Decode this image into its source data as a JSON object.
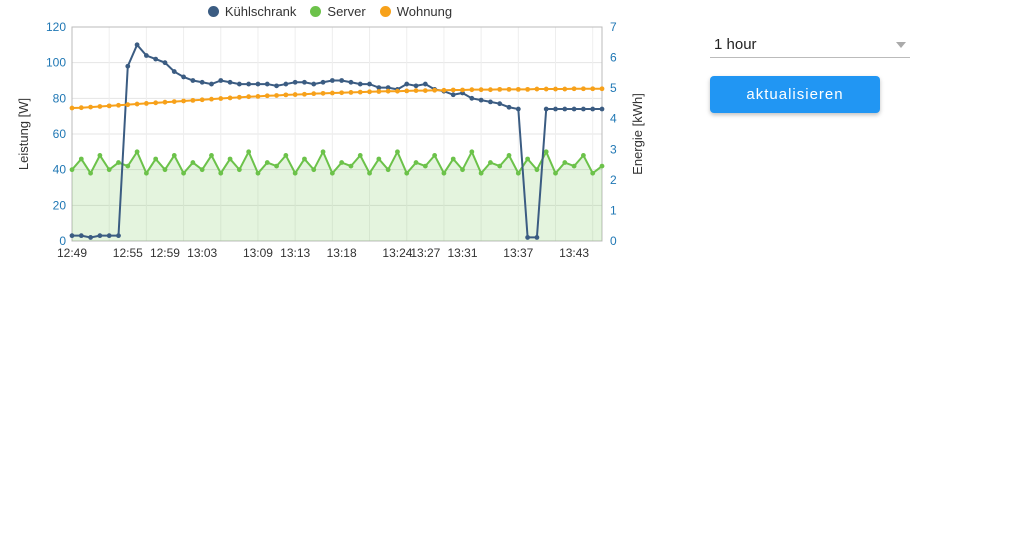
{
  "legend": {
    "items": [
      {
        "name": "Kühlschrank",
        "color": "#3b5c82"
      },
      {
        "name": "Server",
        "color": "#6cc24a"
      },
      {
        "name": "Wohnung",
        "color": "#f7a11a"
      }
    ]
  },
  "controls": {
    "range_selected": "1 hour",
    "refresh_label": "aktualisieren"
  },
  "chart_data": {
    "type": "line",
    "xlabel": "",
    "ylabel_left": "Leistung [W]",
    "ylabel_right": "Energie [kWh]",
    "ylim_left": [
      0,
      120
    ],
    "ylim_right": [
      0,
      7
    ],
    "yticks_left": [
      0,
      20,
      40,
      60,
      80,
      100,
      120
    ],
    "yticks_right": [
      0,
      1,
      2,
      3,
      4,
      5,
      6,
      7
    ],
    "xticks": [
      "12:49",
      "12:55",
      "12:59",
      "13:03",
      "13:09",
      "13:13",
      "13:18",
      "13:24",
      "13:27",
      "13:31",
      "13:37",
      "13:43"
    ],
    "x": [
      "12:49",
      "12:50",
      "12:51",
      "12:52",
      "12:53",
      "12:54",
      "12:55",
      "12:56",
      "12:57",
      "12:58",
      "12:59",
      "13:00",
      "13:01",
      "13:02",
      "13:03",
      "13:04",
      "13:05",
      "13:06",
      "13:07",
      "13:08",
      "13:09",
      "13:10",
      "13:11",
      "13:12",
      "13:13",
      "13:14",
      "13:15",
      "13:16",
      "13:17",
      "13:18",
      "13:19",
      "13:20",
      "13:21",
      "13:22",
      "13:23",
      "13:24",
      "13:25",
      "13:26",
      "13:27",
      "13:28",
      "13:29",
      "13:30",
      "13:31",
      "13:32",
      "13:33",
      "13:34",
      "13:35",
      "13:36",
      "13:37",
      "13:38",
      "13:39",
      "13:40",
      "13:41",
      "13:42",
      "13:43",
      "13:44",
      "13:45",
      "13:46"
    ],
    "series": [
      {
        "name": "Kühlschrank",
        "axis": "left",
        "color": "#3b5c82",
        "fill": false,
        "values": [
          3,
          3,
          2,
          3,
          3,
          3,
          98,
          110,
          104,
          102,
          100,
          95,
          92,
          90,
          89,
          88,
          90,
          89,
          88,
          88,
          88,
          88,
          87,
          88,
          89,
          89,
          88,
          89,
          90,
          90,
          89,
          88,
          88,
          86,
          86,
          85,
          88,
          87,
          88,
          85,
          84,
          82,
          83,
          80,
          79,
          78,
          77,
          75,
          74,
          2,
          2,
          74,
          74,
          74,
          74,
          74,
          74,
          74
        ]
      },
      {
        "name": "Server",
        "axis": "left",
        "color": "#6cc24a",
        "fill": true,
        "values": [
          40,
          46,
          38,
          48,
          40,
          44,
          42,
          50,
          38,
          46,
          40,
          48,
          38,
          44,
          40,
          48,
          38,
          46,
          40,
          50,
          38,
          44,
          42,
          48,
          38,
          46,
          40,
          50,
          38,
          44,
          42,
          48,
          38,
          46,
          40,
          50,
          38,
          44,
          42,
          48,
          38,
          46,
          40,
          50,
          38,
          44,
          42,
          48,
          38,
          46,
          40,
          50,
          38,
          44,
          42,
          48,
          38,
          42
        ]
      },
      {
        "name": "Wohnung",
        "axis": "right",
        "color": "#f7a11a",
        "fill": false,
        "values": [
          4.35,
          4.36,
          4.38,
          4.4,
          4.42,
          4.44,
          4.46,
          4.48,
          4.5,
          4.52,
          4.54,
          4.56,
          4.58,
          4.6,
          4.62,
          4.64,
          4.66,
          4.68,
          4.7,
          4.72,
          4.73,
          4.75,
          4.76,
          4.78,
          4.79,
          4.8,
          4.82,
          4.83,
          4.84,
          4.85,
          4.86,
          4.87,
          4.88,
          4.89,
          4.9,
          4.9,
          4.91,
          4.92,
          4.92,
          4.93,
          4.93,
          4.94,
          4.94,
          4.95,
          4.95,
          4.95,
          4.96,
          4.96,
          4.96,
          4.96,
          4.97,
          4.97,
          4.97,
          4.97,
          4.98,
          4.98,
          4.98,
          4.98
        ]
      }
    ]
  }
}
